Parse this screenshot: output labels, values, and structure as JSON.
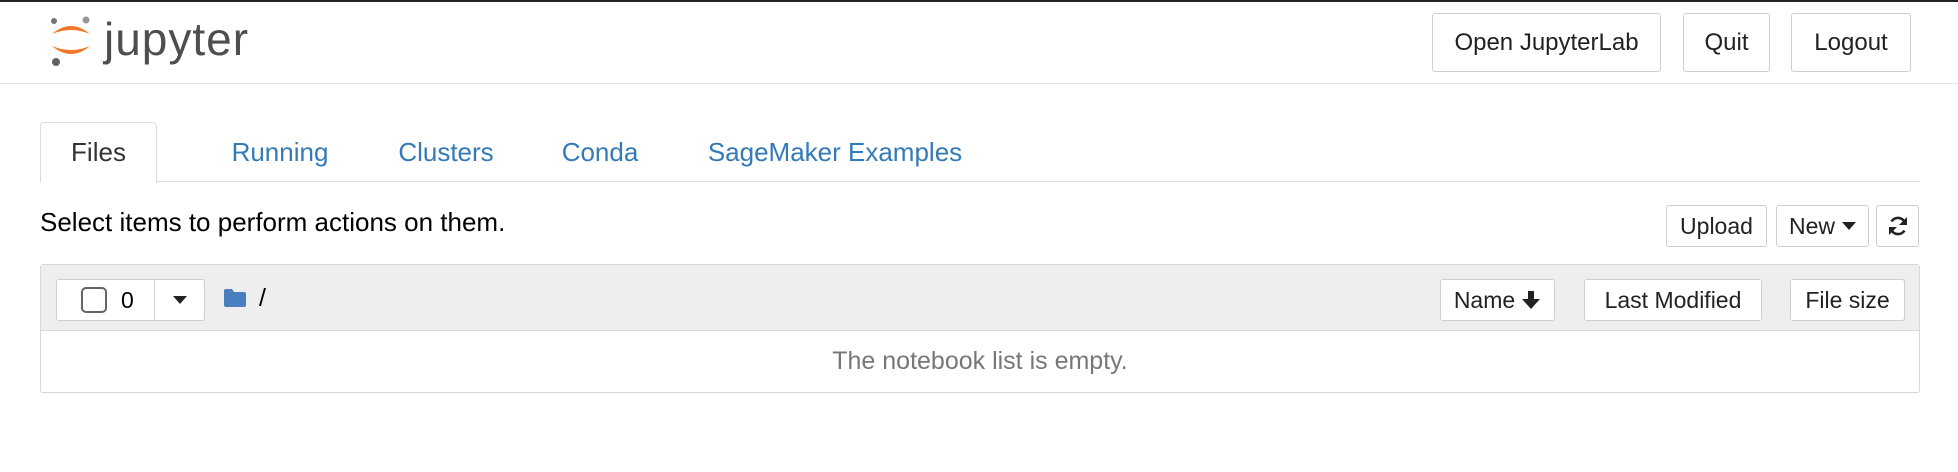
{
  "header": {
    "logo_text": "jupyter",
    "open_lab_label": "Open JupyterLab",
    "quit_label": "Quit",
    "logout_label": "Logout"
  },
  "tabs": [
    {
      "label": "Files",
      "active": true
    },
    {
      "label": "Running",
      "active": false
    },
    {
      "label": "Clusters",
      "active": false
    },
    {
      "label": "Conda",
      "active": false
    },
    {
      "label": "SageMaker Examples",
      "active": false
    }
  ],
  "toolbar": {
    "hint": "Select items to perform actions on them.",
    "upload_label": "Upload",
    "new_label": "New",
    "refresh_icon": "refresh-icon"
  },
  "list": {
    "selected_count": "0",
    "path": "/",
    "columns": {
      "name": "Name",
      "last_modified": "Last Modified",
      "file_size": "File size"
    },
    "empty_message": "The notebook list is empty."
  },
  "colors": {
    "link": "#337ab7",
    "logo_orange": "#f37726",
    "logo_gray": "#616262",
    "folder": "#4a7fbf"
  }
}
